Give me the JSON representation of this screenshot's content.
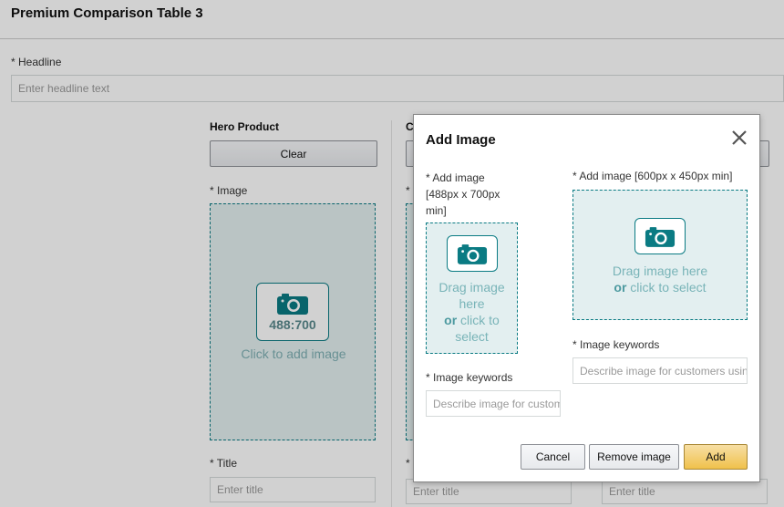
{
  "page": {
    "title": "Premium Comparison Table 3",
    "headline_label": "* Headline",
    "headline_placeholder": "Enter headline text"
  },
  "hero": {
    "column_title": "Hero Product",
    "clear_label": "Clear",
    "image_label": "* Image",
    "ratio": "488:700",
    "click_text": "Click to add image",
    "title_label": "* Title",
    "title_placeholder": "Enter title"
  },
  "column2": {
    "column_title_fragment": "C",
    "image_label_fragment": "*",
    "title_label_fragment": "*",
    "title_placeholder": "Enter title"
  },
  "column3": {
    "title_placeholder": "Enter title"
  },
  "modal": {
    "title": "Add Image",
    "left": {
      "label_line1": "* Add image",
      "label_line2": "[488px x 700px",
      "label_line3": "min]",
      "drag_line1": "Drag image",
      "drag_line2": "here",
      "drag_or": "or",
      "drag_line3": " click to",
      "drag_line4": "select",
      "keywords_label": "* Image keywords",
      "keywords_placeholder": "Describe image for customers using"
    },
    "right": {
      "label": "* Add image [600px x 450px min]",
      "drag_line1": "Drag image here",
      "drag_or": "or",
      "drag_line2": " click to select",
      "keywords_label": "* Image keywords",
      "keywords_placeholder": "Describe image for customers using"
    },
    "buttons": {
      "cancel": "Cancel",
      "remove": "Remove image",
      "add": "Add"
    }
  },
  "colors": {
    "accent": "#0a7b83",
    "dropzone_bg": "#e3eff0",
    "primary_button": "#f0c14b"
  },
  "icons": {
    "camera": "camera-icon",
    "close": "close-icon"
  }
}
